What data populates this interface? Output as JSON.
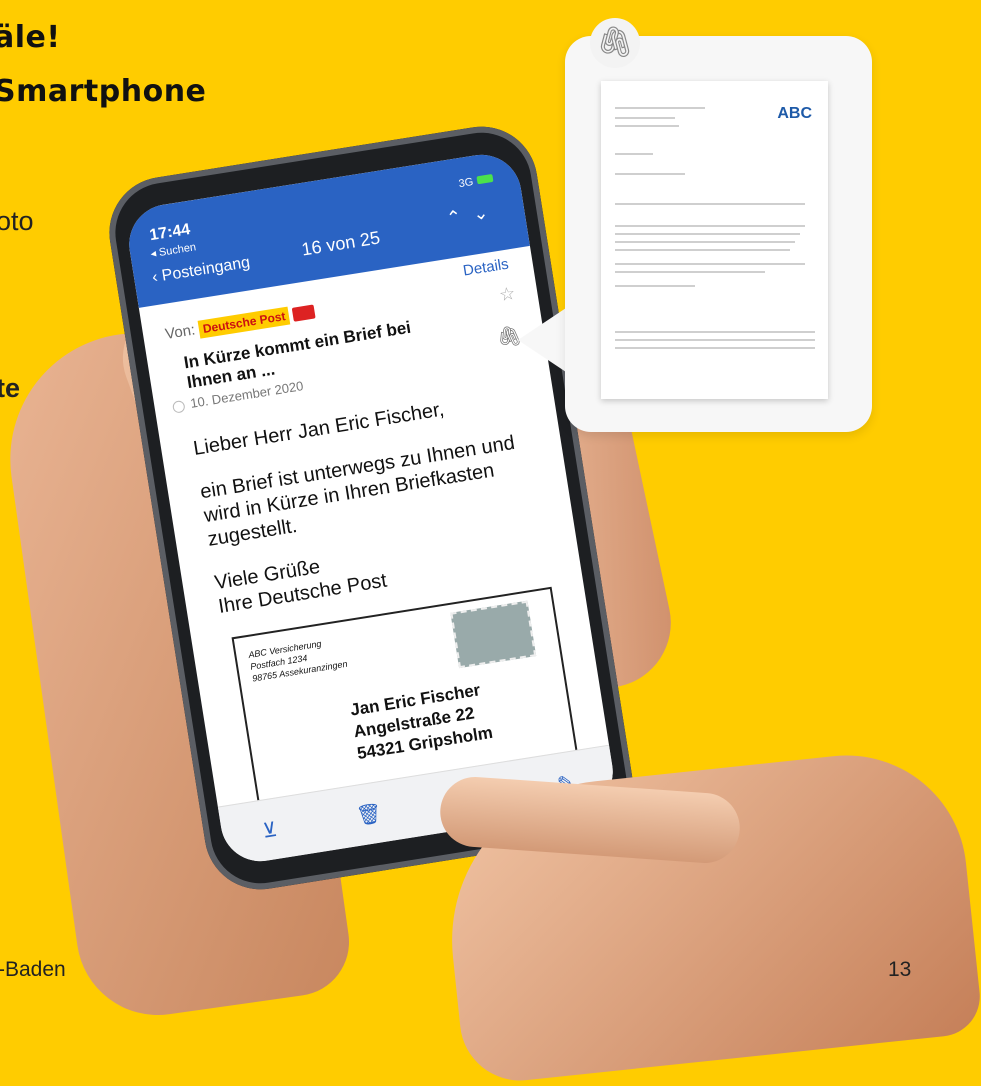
{
  "headline": {
    "line1": "äle!",
    "line2": "Smartphone"
  },
  "fragments": {
    "oto": "oto",
    "te": "te"
  },
  "footer": {
    "left": "-Baden",
    "page_number": "13"
  },
  "phone": {
    "status_bar": {
      "time": "17:44",
      "network": "3G",
      "back_label": "Suchen"
    },
    "nav": {
      "back_label": "Posteingang",
      "counter": "16 von 25",
      "details": "Details"
    },
    "email": {
      "from_label": "Von:",
      "sender": "Deutsche Post",
      "subject": "In Kürze kommt ein Brief bei Ihnen an ...",
      "date": "10. Dezember 2020",
      "greeting": "Lieber Herr Jan Eric Fischer,",
      "body": "ein Brief ist unterwegs zu Ihnen und wird in Kürze in Ihren Briefkasten zugestellt.",
      "closing_1": "Viele Grüße",
      "closing_2": "Ihre Deutsche Post"
    },
    "envelope": {
      "sender_line1": "ABC Versicherung",
      "sender_line2": "Postfach 1234",
      "sender_line3": "98765 Assekuranzingen",
      "recipient_name": "Jan Eric Fischer",
      "recipient_street": "Angelstraße 22",
      "recipient_city": "54321 Gripsholm"
    }
  },
  "preview": {
    "logo": "ABC"
  }
}
